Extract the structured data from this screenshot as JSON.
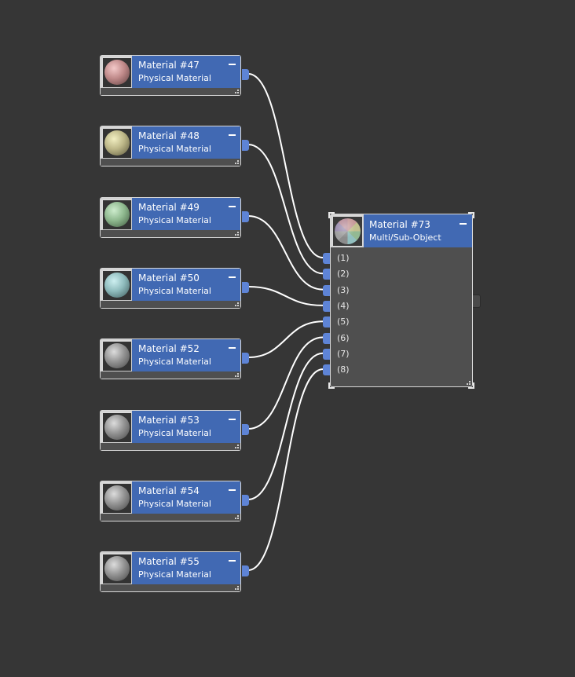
{
  "source_nodes": [
    {
      "title": "Material #47",
      "subtitle": "Physical Material",
      "swatch": {
        "hi": "#f3c9c9",
        "mid": "#c08a8a",
        "dark": "#5d3e3e"
      }
    },
    {
      "title": "Material #48",
      "subtitle": "Physical Material",
      "swatch": {
        "hi": "#f2efc2",
        "mid": "#bdb788",
        "dark": "#5b573c"
      }
    },
    {
      "title": "Material #49",
      "subtitle": "Physical Material",
      "swatch": {
        "hi": "#cdeccd",
        "mid": "#8fb98f",
        "dark": "#3f5a3f"
      }
    },
    {
      "title": "Material #50",
      "subtitle": "Physical Material",
      "swatch": {
        "hi": "#cdeff0",
        "mid": "#8fbcbd",
        "dark": "#3d5a5b"
      }
    },
    {
      "title": "Material #52",
      "subtitle": "Physical Material",
      "swatch": {
        "hi": "#dcdcdc",
        "mid": "#949494",
        "dark": "#454545"
      }
    },
    {
      "title": "Material #53",
      "subtitle": "Physical Material",
      "swatch": {
        "hi": "#dcdcdc",
        "mid": "#949494",
        "dark": "#454545"
      }
    },
    {
      "title": "Material #54",
      "subtitle": "Physical Material",
      "swatch": {
        "hi": "#dcdcdc",
        "mid": "#949494",
        "dark": "#454545"
      }
    },
    {
      "title": "Material #55",
      "subtitle": "Physical Material",
      "swatch": {
        "hi": "#dcdcdc",
        "mid": "#949494",
        "dark": "#454545"
      }
    }
  ],
  "target_node": {
    "title": "Material #73",
    "subtitle": "Multi/Sub-Object",
    "slots": [
      "(1)",
      "(2)",
      "(3)",
      "(4)",
      "(5)",
      "(6)",
      "(7)",
      "(8)"
    ]
  },
  "icons": {
    "minimize": "minimize-icon",
    "resize": "resize-grip-icon"
  },
  "colors": {
    "background": "#363636",
    "header": "#4169b3",
    "socket": "#5e84d6",
    "wire": "#ffffff"
  }
}
